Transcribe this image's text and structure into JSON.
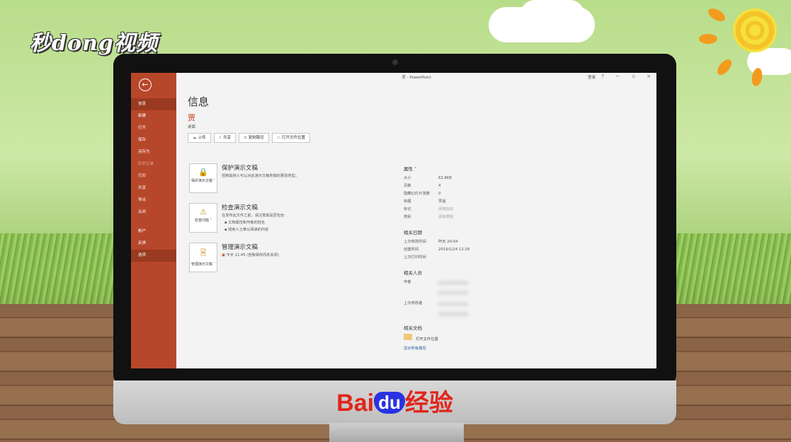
{
  "overlay": {
    "logo_text": "秒dong视频",
    "stand_brand": {
      "bai": "Bai",
      "du": "du",
      "jingyan": "经验"
    }
  },
  "window": {
    "title": "贾 - PowerPoint",
    "login": "登录",
    "help": "?",
    "minimize": "−",
    "restore": "▫",
    "close": "×"
  },
  "sidebar": {
    "back_symbol": "←",
    "items": [
      {
        "label": "信息",
        "state": "active"
      },
      {
        "label": "新建",
        "state": "normal"
      },
      {
        "label": "打开",
        "state": "normal"
      },
      {
        "label": "保存",
        "state": "normal"
      },
      {
        "label": "另存为",
        "state": "normal"
      },
      {
        "label": "历史记录",
        "state": "disabled"
      },
      {
        "label": "打印",
        "state": "normal"
      },
      {
        "label": "共享",
        "state": "normal"
      },
      {
        "label": "导出",
        "state": "normal"
      },
      {
        "label": "关闭",
        "state": "normal"
      }
    ],
    "bottom_items": [
      {
        "label": "帐户",
        "state": "normal"
      },
      {
        "label": "反馈",
        "state": "normal"
      },
      {
        "label": "选项",
        "state": "active"
      }
    ]
  },
  "info": {
    "page_title": "信息",
    "doc_name": "贾",
    "doc_location": "桌面",
    "actions": [
      {
        "icon": "☁",
        "label": "上传"
      },
      {
        "icon": "⇧",
        "label": "共享"
      },
      {
        "icon": "⊘",
        "label": "复制路径"
      },
      {
        "icon": "▭",
        "label": "打开文件位置"
      }
    ]
  },
  "sections": {
    "protect": {
      "tile_label": "保护演示文稿",
      "title": "保护演示文稿",
      "desc": "控制其他人可以对此演示文稿所做的更改类型。"
    },
    "inspect": {
      "tile_label": "检查问题",
      "title": "检查演示文稿",
      "desc": "在发布此文件之前，请注意其是否包含:",
      "bullets": [
        "文档属性和作者的姓名",
        "残疾人士难以阅读的内容"
      ]
    },
    "manage": {
      "tile_label": "管理演示文稿",
      "title": "管理演示文稿",
      "desc": "今天 11:45 (自我保存而未关闭)"
    }
  },
  "properties": {
    "heading": "属性 ˅",
    "rows": [
      {
        "key": "大小",
        "value": "62.8KB"
      },
      {
        "key": "页数",
        "value": "4"
      },
      {
        "key": "隐藏幻灯片张数",
        "value": "0"
      },
      {
        "key": "标题",
        "value": "贾谊"
      },
      {
        "key": "标记",
        "value": "添加标记",
        "hint": true
      },
      {
        "key": "类别",
        "value": "添加类别",
        "hint": true
      }
    ],
    "dates_heading": "相关日期",
    "dates": [
      {
        "key": "上次修改时间",
        "value": "昨天 20:04"
      },
      {
        "key": "创建时间",
        "value": "2019/1/24 12:18"
      },
      {
        "key": "上次打印时间",
        "value": ""
      }
    ],
    "people_heading": "相关人员",
    "people": [
      {
        "key": "作者"
      },
      {
        "key": "上次修改者"
      }
    ],
    "docs_heading": "相关文档",
    "open_location": "打开文件位置",
    "show_all": "显示所有属性"
  }
}
